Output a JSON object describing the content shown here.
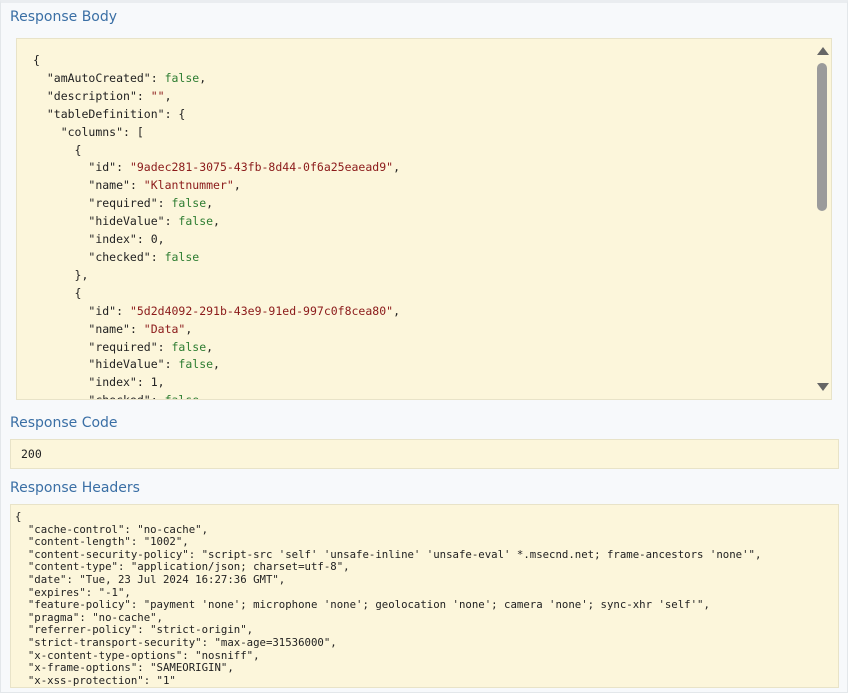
{
  "response_body": {
    "title": "Response Body",
    "lines": [
      [
        [
          "p",
          "{"
        ]
      ],
      [
        [
          "i",
          "  "
        ],
        [
          "k",
          "\"amAutoCreated\""
        ],
        [
          "p",
          ": "
        ],
        [
          "b",
          "false"
        ],
        [
          "p",
          ","
        ]
      ],
      [
        [
          "i",
          "  "
        ],
        [
          "k",
          "\"description\""
        ],
        [
          "p",
          ": "
        ],
        [
          "s",
          "\"\""
        ],
        [
          "p",
          ","
        ]
      ],
      [
        [
          "i",
          "  "
        ],
        [
          "k",
          "\"tableDefinition\""
        ],
        [
          "p",
          ": {"
        ]
      ],
      [
        [
          "i",
          "    "
        ],
        [
          "k",
          "\"columns\""
        ],
        [
          "p",
          ": ["
        ]
      ],
      [
        [
          "i",
          "      "
        ],
        [
          "p",
          "{"
        ]
      ],
      [
        [
          "i",
          "        "
        ],
        [
          "k",
          "\"id\""
        ],
        [
          "p",
          ": "
        ],
        [
          "s",
          "\"9adec281-3075-43fb-8d44-0f6a25eaead9\""
        ],
        [
          "p",
          ","
        ]
      ],
      [
        [
          "i",
          "        "
        ],
        [
          "k",
          "\"name\""
        ],
        [
          "p",
          ": "
        ],
        [
          "s",
          "\"Klantnummer\""
        ],
        [
          "p",
          ","
        ]
      ],
      [
        [
          "i",
          "        "
        ],
        [
          "k",
          "\"required\""
        ],
        [
          "p",
          ": "
        ],
        [
          "b",
          "false"
        ],
        [
          "p",
          ","
        ]
      ],
      [
        [
          "i",
          "        "
        ],
        [
          "k",
          "\"hideValue\""
        ],
        [
          "p",
          ": "
        ],
        [
          "b",
          "false"
        ],
        [
          "p",
          ","
        ]
      ],
      [
        [
          "i",
          "        "
        ],
        [
          "k",
          "\"index\""
        ],
        [
          "p",
          ": "
        ],
        [
          "n",
          "0"
        ],
        [
          "p",
          ","
        ]
      ],
      [
        [
          "i",
          "        "
        ],
        [
          "k",
          "\"checked\""
        ],
        [
          "p",
          ": "
        ],
        [
          "b",
          "false"
        ]
      ],
      [
        [
          "i",
          "      "
        ],
        [
          "p",
          "},"
        ]
      ],
      [
        [
          "i",
          "      "
        ],
        [
          "p",
          "{"
        ]
      ],
      [
        [
          "i",
          "        "
        ],
        [
          "k",
          "\"id\""
        ],
        [
          "p",
          ": "
        ],
        [
          "s",
          "\"5d2d4092-291b-43e9-91ed-997c0f8cea80\""
        ],
        [
          "p",
          ","
        ]
      ],
      [
        [
          "i",
          "        "
        ],
        [
          "k",
          "\"name\""
        ],
        [
          "p",
          ": "
        ],
        [
          "s",
          "\"Data\""
        ],
        [
          "p",
          ","
        ]
      ],
      [
        [
          "i",
          "        "
        ],
        [
          "k",
          "\"required\""
        ],
        [
          "p",
          ": "
        ],
        [
          "b",
          "false"
        ],
        [
          "p",
          ","
        ]
      ],
      [
        [
          "i",
          "        "
        ],
        [
          "k",
          "\"hideValue\""
        ],
        [
          "p",
          ": "
        ],
        [
          "b",
          "false"
        ],
        [
          "p",
          ","
        ]
      ],
      [
        [
          "i",
          "        "
        ],
        [
          "k",
          "\"index\""
        ],
        [
          "p",
          ": "
        ],
        [
          "n",
          "1"
        ],
        [
          "p",
          ","
        ]
      ],
      [
        [
          "i",
          "        "
        ],
        [
          "k",
          "\"checked\""
        ],
        [
          "p",
          ": "
        ],
        [
          "b",
          "false"
        ]
      ]
    ]
  },
  "response_code": {
    "title": "Response Code",
    "value": "200"
  },
  "response_headers": {
    "title": "Response Headers",
    "text": "{\n  \"cache-control\": \"no-cache\",\n  \"content-length\": \"1002\",\n  \"content-security-policy\": \"script-src 'self' 'unsafe-inline' 'unsafe-eval' *.msecnd.net; frame-ancestors 'none'\",\n  \"content-type\": \"application/json; charset=utf-8\",\n  \"date\": \"Tue, 23 Jul 2024 16:27:36 GMT\",\n  \"expires\": \"-1\",\n  \"feature-policy\": \"payment 'none'; microphone 'none'; geolocation 'none'; camera 'none'; sync-xhr 'self'\",\n  \"pragma\": \"no-cache\",\n  \"referrer-policy\": \"strict-origin\",\n  \"strict-transport-security\": \"max-age=31536000\",\n  \"x-content-type-options\": \"nosniff\",\n  \"x-frame-options\": \"SAMEORIGIN\",\n  \"x-xss-protection\": \"1\"\n}"
  },
  "colors": {
    "title": "#3a6fa5",
    "code_background": "#fcf6db",
    "string": "#8b1a1a",
    "boolean": "#2e7d32"
  },
  "icons": {
    "scroll_up": "arrow-up-icon",
    "scroll_down": "arrow-down-icon"
  }
}
